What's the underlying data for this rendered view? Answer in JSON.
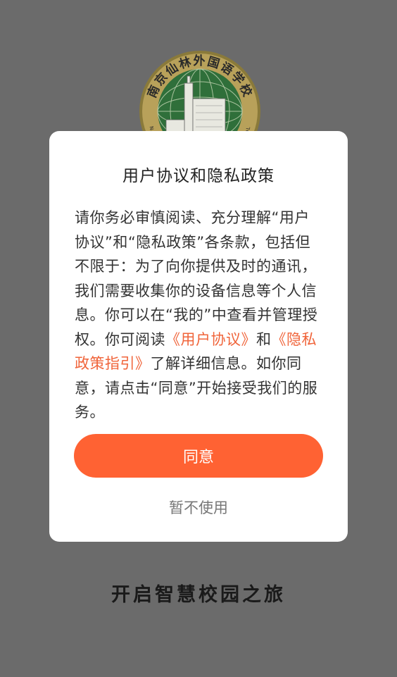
{
  "logo": {
    "name_cn": "南京仙林外国语学校",
    "name_en": "NANJING XIANLIN FOREIGN LANGUAGE SCHOOL"
  },
  "dialog": {
    "title": "用户协议和隐私政策",
    "body_part1": "请你务必审慎阅读、充分理解“用户协议”和“隐私政策”各条款，包括但不限于：为了向你提供及时的通讯，我们需要收集你的设备信息等个人信息。你可以在“我的”中查看并管理授权。你可阅读",
    "link_user_agreement": "《用户协议》",
    "body_and": "和",
    "link_privacy_guide": "《隐私政策指引》",
    "body_part2": "了解详细信息。如你同意，请点击“同意”开始接受我们的服务。",
    "agree_label": "同意",
    "decline_label": "暂不使用"
  },
  "slogan": "开启智慧校园之旅",
  "colors": {
    "accent": "#ff6233",
    "link": "#f0643a",
    "overlay": "#6b6b6b"
  }
}
